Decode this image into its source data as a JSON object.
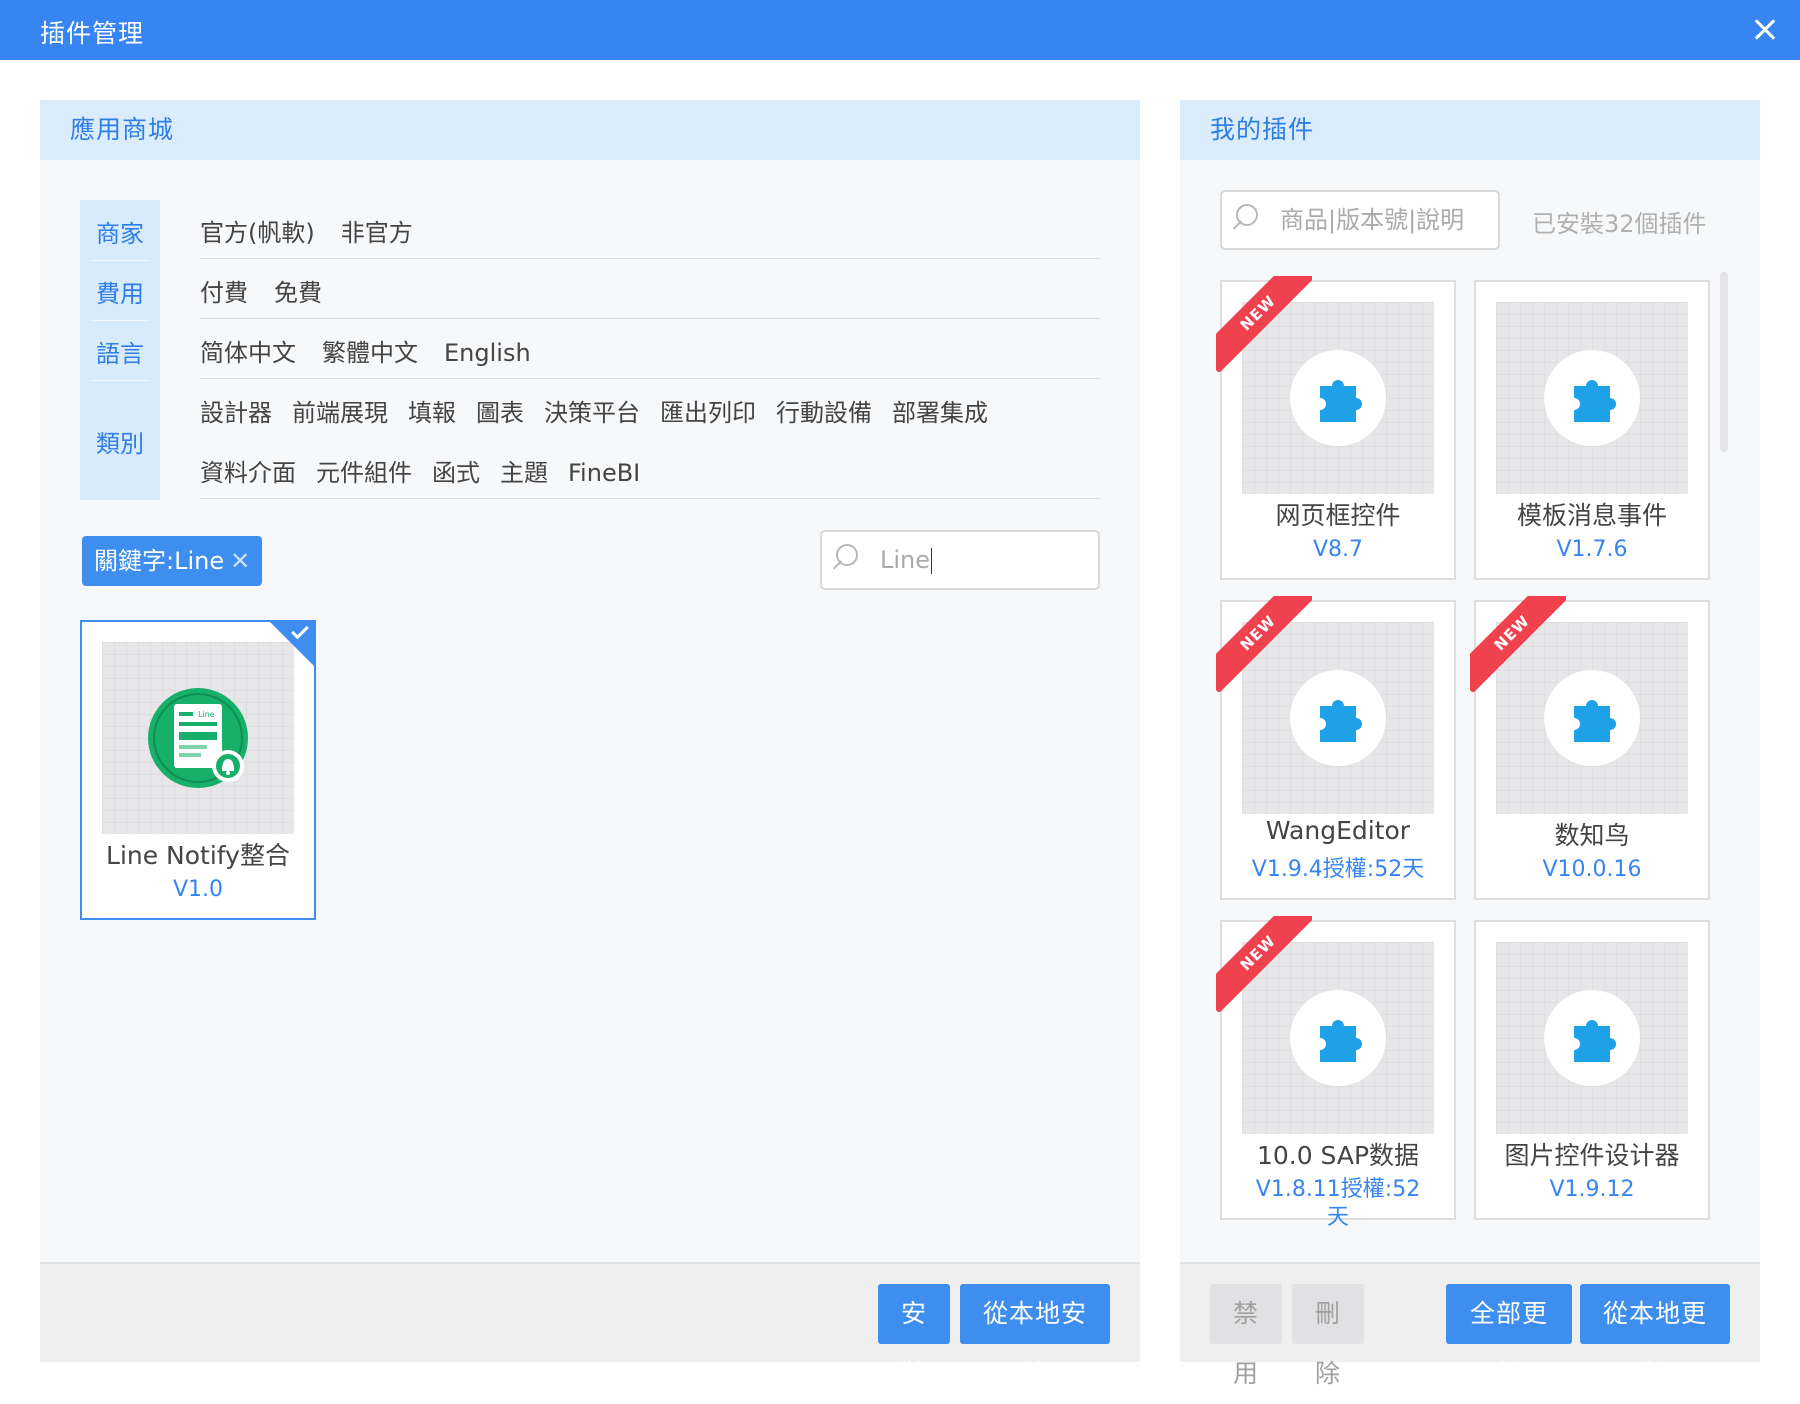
{
  "window": {
    "title": "插件管理"
  },
  "store": {
    "header": "應用商城",
    "filters": {
      "vendor": {
        "label": "商家",
        "options": [
          "官方(帆軟)",
          "非官方"
        ]
      },
      "cost": {
        "label": "費用",
        "options": [
          "付費",
          "免費"
        ]
      },
      "language": {
        "label": "語言",
        "options": [
          "简体中文",
          "繁體中文",
          "English"
        ]
      },
      "category": {
        "label": "類別",
        "options_row1": [
          "設計器",
          "前端展現",
          "填報",
          "圖表",
          "決策平台",
          "匯出列印",
          "行動設備",
          "部署集成"
        ],
        "options_row2": [
          "資料介面",
          "元件組件",
          "函式",
          "主題",
          "FineBI"
        ]
      }
    },
    "keyword_tag": "關鍵字:Line",
    "search": {
      "value": "Line"
    },
    "results": [
      {
        "name": "Line Notify整合",
        "version": "V1.0",
        "selected": true,
        "icon": "line-notify-icon",
        "icon_text": "Line"
      }
    ],
    "buttons": {
      "install": "安裝",
      "install_local": "從本地安裝"
    }
  },
  "mine": {
    "header": "我的插件",
    "search": {
      "placeholder": "商品|版本號|說明"
    },
    "installed_count": "已安裝32個插件",
    "plugins": [
      {
        "name": "网页框控件",
        "version": "V8.7",
        "is_new": true
      },
      {
        "name": "模板消息事件",
        "version": "V1.7.6",
        "is_new": false
      },
      {
        "name": "WangEditor",
        "version": "V1.9.4授權:52天",
        "is_new": true
      },
      {
        "name": "数知鸟",
        "version": "V10.0.16",
        "is_new": true
      },
      {
        "name": "10.0 SAP数据",
        "version": "V1.8.11授權:52天",
        "is_new": true
      },
      {
        "name": "图片控件设计器",
        "version": "V1.9.12",
        "is_new": false
      }
    ],
    "ribbon_text": "NEW",
    "buttons": {
      "disable": "禁用",
      "delete": "刪除",
      "update_all": "全部更新",
      "update_local": "從本地更新"
    }
  },
  "colors": {
    "primary": "#3685f2",
    "header_bg": "#dbedfd",
    "ribbon": "#f0424e",
    "puzzle": "#1ea1e6",
    "line_green": "#18b06a"
  }
}
